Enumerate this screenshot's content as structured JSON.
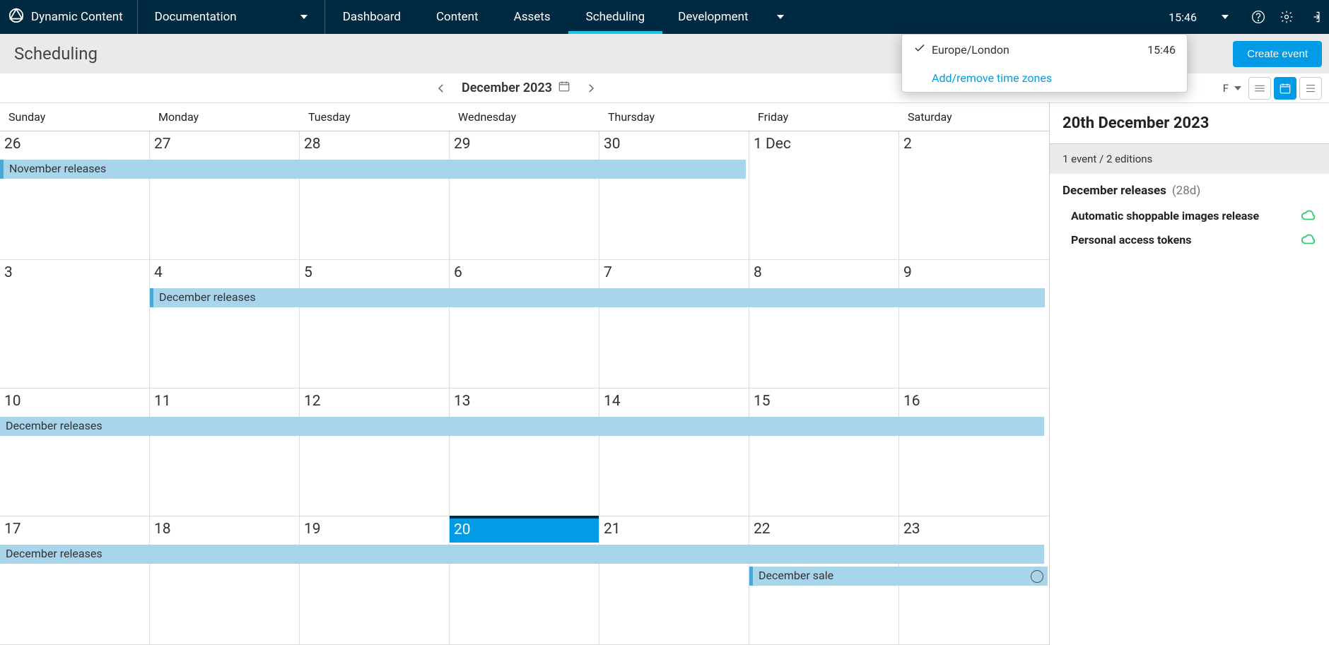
{
  "nav": {
    "brand": "Dynamic Content",
    "doc": "Documentation",
    "tabs": {
      "dashboard": "Dashboard",
      "content": "Content",
      "assets": "Assets",
      "scheduling": "Scheduling"
    },
    "dev": "Development",
    "clock": "15:46"
  },
  "tz": {
    "zone": "Europe/London",
    "time": "15:46",
    "add": "Add/remove time zones"
  },
  "subhead": {
    "title": "Scheduling",
    "create": "Create event"
  },
  "toolbar": {
    "month": "December 2023",
    "filterTrail": "F"
  },
  "days": [
    "Sunday",
    "Monday",
    "Tuesday",
    "Wednesday",
    "Thursday",
    "Friday",
    "Saturday"
  ],
  "cells": [
    "26",
    "27",
    "28",
    "29",
    "30",
    "1 Dec",
    "2",
    "3",
    "4",
    "5",
    "6",
    "7",
    "8",
    "9",
    "10",
    "11",
    "12",
    "13",
    "14",
    "15",
    "16",
    "17",
    "18",
    "19",
    "20",
    "21",
    "22",
    "23"
  ],
  "events": {
    "nov": "November releases",
    "dec": "December releases",
    "sale": "December sale"
  },
  "side": {
    "title": "20th December 2023",
    "sub": "1 event / 2 editions",
    "evt": "December releases",
    "dur": "(28d)",
    "ed1": "Automatic shoppable images release",
    "ed2": "Personal access tokens"
  }
}
